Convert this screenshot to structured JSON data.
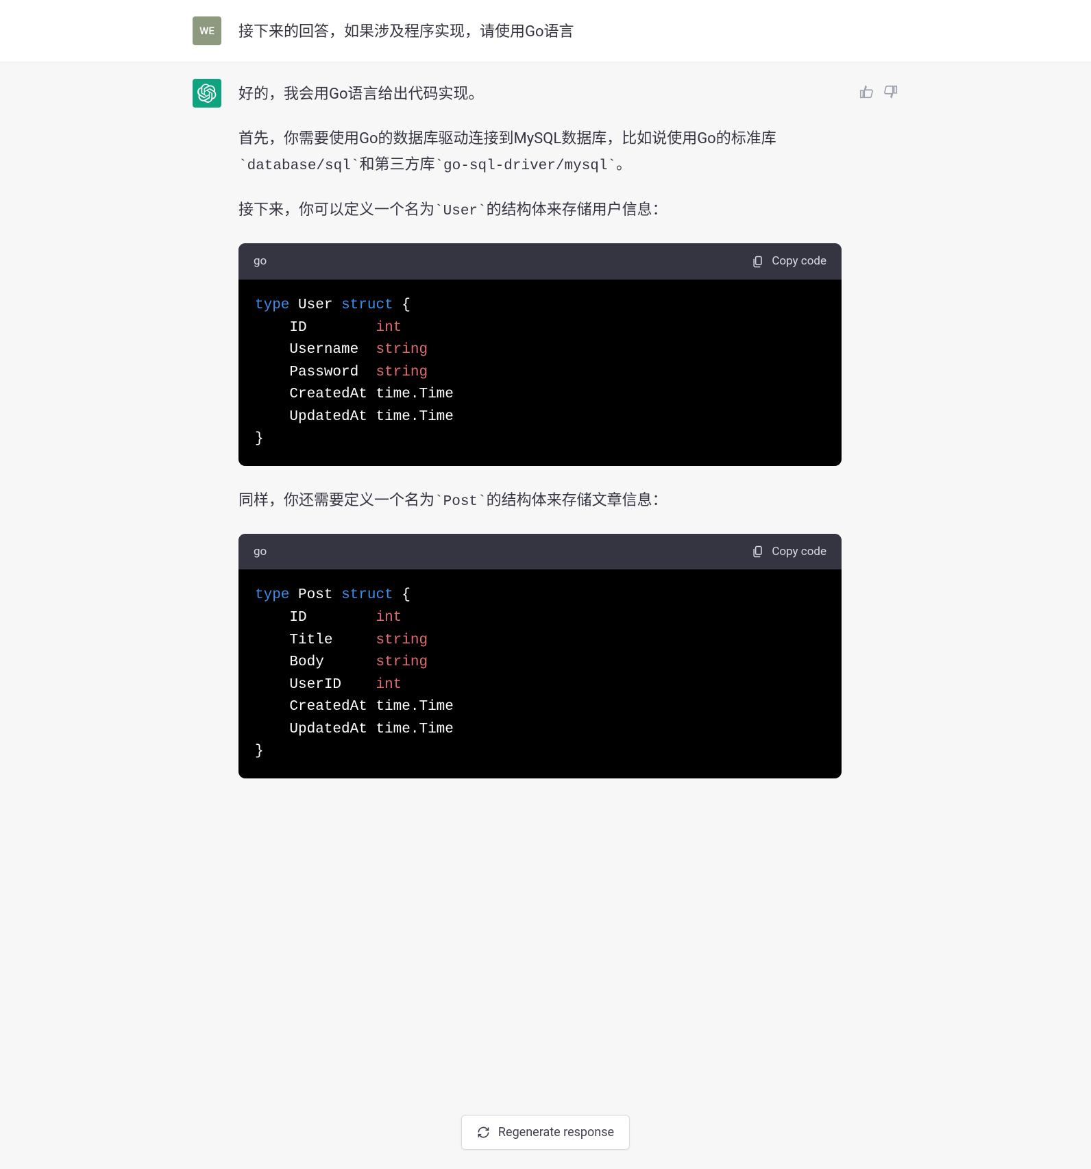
{
  "user": {
    "avatar_text": "WE",
    "message": "接下来的回答，如果涉及程序实现，请使用Go语言"
  },
  "assistant": {
    "p1": "好的，我会用Go语言给出代码实现。",
    "p2_pre": "首先，你需要使用Go的数据库驱动连接到MySQL数据库，比如说使用Go的标准库",
    "p2_code1": "`database/sql`",
    "p2_mid": "和第三方库",
    "p2_code2": "`go-sql-driver/mysql`",
    "p2_post": "。",
    "p3_pre": "接下来，你可以定义一个名为",
    "p3_code": "`User`",
    "p3_post": "的结构体来存储用户信息：",
    "p4_pre": "同样，你还需要定义一个名为",
    "p4_code": "`Post`",
    "p4_post": "的结构体来存储文章信息："
  },
  "codeblocks": [
    {
      "lang": "go",
      "copy_label": "Copy code"
    },
    {
      "lang": "go",
      "copy_label": "Copy code"
    }
  ],
  "code1": {
    "kw_type": "type",
    "name": "User",
    "kw_struct": "struct",
    "brace_open": "{",
    "f1_name": "ID",
    "f1_type": "int",
    "f2_name": "Username",
    "f2_type": "string",
    "f3_name": "Password",
    "f3_type": "string",
    "f4_name": "CreatedAt",
    "f4_type": "time.Time",
    "f5_name": "UpdatedAt",
    "f5_type": "time.Time",
    "brace_close": "}"
  },
  "code2": {
    "kw_type": "type",
    "name": "Post",
    "kw_struct": "struct",
    "brace_open": "{",
    "f1_name": "ID",
    "f1_type": "int",
    "f2_name": "Title",
    "f2_type": "string",
    "f3_name": "Body",
    "f3_type": "string",
    "f4_name": "UserID",
    "f4_type": "int",
    "f5_name": "CreatedAt",
    "f5_type": "time.Time",
    "f6_name": "UpdatedAt",
    "f6_type": "time.Time",
    "brace_close": "}"
  },
  "regenerate_label": "Regenerate response"
}
